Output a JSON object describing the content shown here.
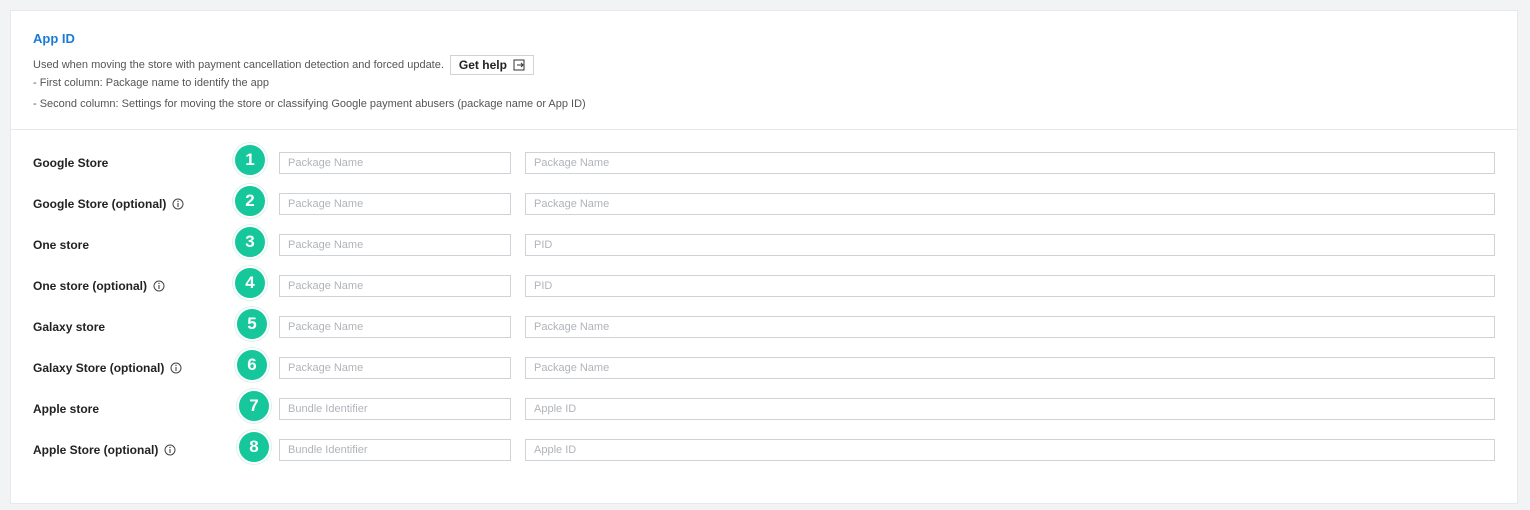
{
  "header": {
    "title": "App ID",
    "description": "Used when moving the store with payment cancellation detection and forced update.",
    "help_label": "Get help",
    "lines": [
      "- First column: Package name to identify the app",
      "- Second column: Settings for moving the store or classifying Google payment abusers (package name or App ID)"
    ]
  },
  "rows": [
    {
      "label": "Google Store",
      "badge": "1",
      "info": false,
      "col1_placeholder": "Package Name",
      "col2_placeholder": "Package Name"
    },
    {
      "label": "Google Store (optional)",
      "badge": "2",
      "info": true,
      "col1_placeholder": "Package Name",
      "col2_placeholder": "Package Name"
    },
    {
      "label": "One store",
      "badge": "3",
      "info": false,
      "col1_placeholder": "Package Name",
      "col2_placeholder": "PID"
    },
    {
      "label": "One store (optional)",
      "badge": "4",
      "info": true,
      "col1_placeholder": "Package Name",
      "col2_placeholder": "PID"
    },
    {
      "label": "Galaxy store",
      "badge": "5",
      "info": false,
      "col1_placeholder": "Package Name",
      "col2_placeholder": "Package Name"
    },
    {
      "label": "Galaxy Store (optional)",
      "badge": "6",
      "info": true,
      "col1_placeholder": "Package Name",
      "col2_placeholder": "Package Name"
    },
    {
      "label": "Apple store",
      "badge": "7",
      "info": false,
      "col1_placeholder": "Bundle Identifier",
      "col2_placeholder": "Apple ID"
    },
    {
      "label": "Apple Store (optional)",
      "badge": "8",
      "info": true,
      "col1_placeholder": "Bundle Identifier",
      "col2_placeholder": "Apple ID"
    }
  ],
  "colors": {
    "accent": "#1a7ad6",
    "badge": "#15c79a"
  },
  "icons": {
    "help": "external-link-icon",
    "info": "info-icon"
  }
}
